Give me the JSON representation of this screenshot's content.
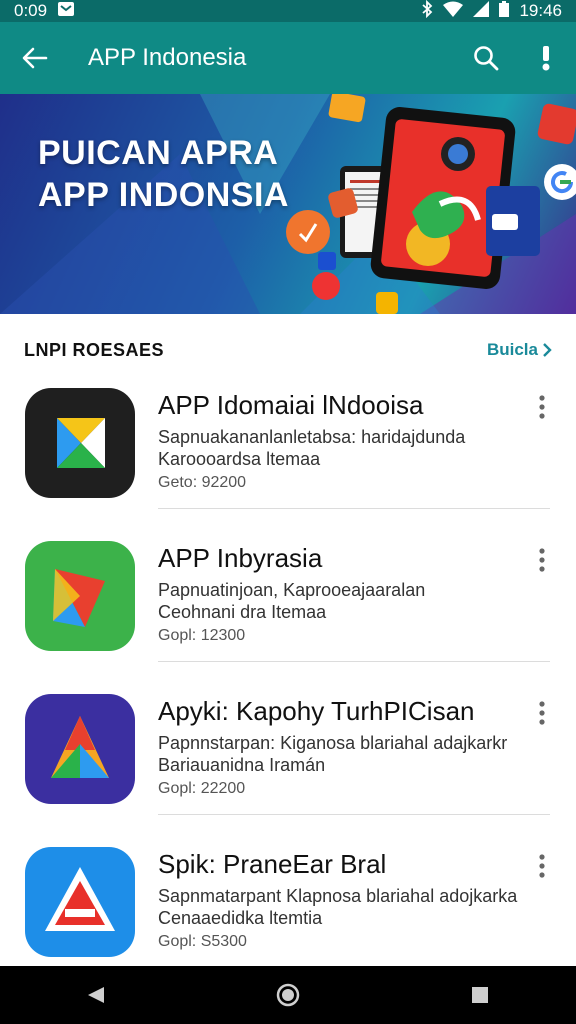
{
  "status_bar": {
    "time_left": "0:09",
    "time_right": "19:46"
  },
  "app_bar": {
    "title": "APP Indonesia",
    "back_icon": "arrow-left-icon",
    "search_icon": "search-icon",
    "more_icon": "more-vert-icon"
  },
  "banner": {
    "title": "PUICAN APRA\nAPP INDONSIA"
  },
  "section": {
    "title": "LNPI ROESAES",
    "see_all": "Buicla"
  },
  "apps": [
    {
      "name": "APP Idomaiai lNdooisa",
      "description": "Sapnuakananlanletabsa: haridajdunda\nKaroooardsa ltemaa",
      "meta": "Geto: 92200",
      "icon": "m-logo-icon",
      "colors": {
        "bg": "#1f1f1f"
      }
    },
    {
      "name": "APP Inbyrasia",
      "description": "Papnuatinjoan, Kaprooeajaaralan\nCeohnani dra Itemaa",
      "meta": "Gopl: 12300",
      "icon": "prism-logo-icon",
      "colors": {
        "bg": "#3cb24a"
      }
    },
    {
      "name": "Apyki: Kapohy TurhPICisan",
      "description": "Papnnstarpan: Kiganosa blariahal adajkarkr\nBariauanidna Iramán",
      "meta": "Gopl: 22200",
      "icon": "a-prism-logo-icon",
      "colors": {
        "bg": "#3b2fa0"
      }
    },
    {
      "name": "Spik: PraneEar Bral",
      "description": "Sapnmatarpant Klapnosa blariahal adojkarka\nCenaaedidka ltemtia",
      "meta": "Gopl: S5300",
      "icon": "a-logo-icon",
      "colors": {
        "bg": "#1e8ee8"
      }
    }
  ],
  "nav_bar": {
    "back": "triangle-back-icon",
    "home": "circle-home-icon",
    "recents": "square-recents-icon"
  },
  "colors": {
    "status_bar": "#0b6b68",
    "app_bar": "#0f8a85",
    "accent": "#1a8a9a"
  }
}
